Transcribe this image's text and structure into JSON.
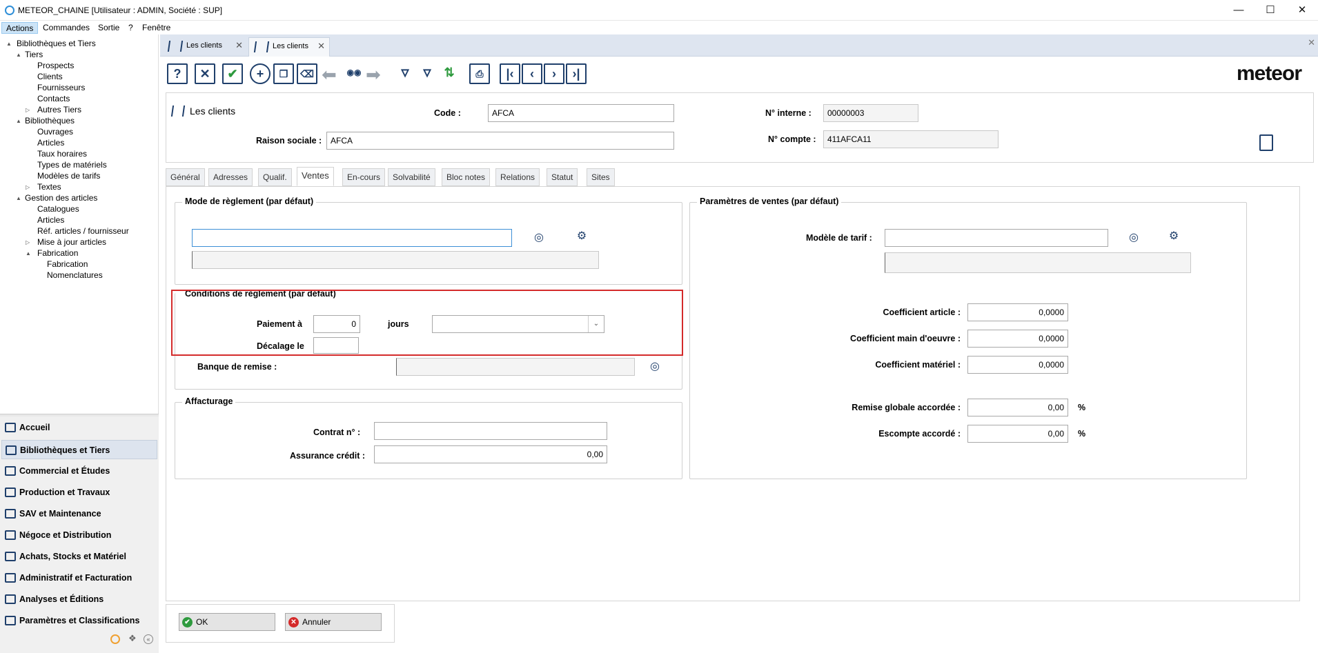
{
  "window": {
    "title": "METEOR_CHAINE [Utilisateur : ADMIN, Société : SUP]"
  },
  "menu": [
    "Actions",
    "Commandes",
    "Sortie",
    "?",
    "Fenêtre"
  ],
  "tree": [
    {
      "label": "Bibliothèques et Tiers",
      "level": 0,
      "expander": "▲"
    },
    {
      "label": "Tiers",
      "level": 1,
      "expander": "▲"
    },
    {
      "label": "Prospects",
      "level": 2
    },
    {
      "label": "Clients",
      "level": 2
    },
    {
      "label": "Fournisseurs",
      "level": 2
    },
    {
      "label": "Contacts",
      "level": 2
    },
    {
      "label": "Autres Tiers",
      "level": 2,
      "expander": "▷"
    },
    {
      "label": "Bibliothèques",
      "level": 1,
      "expander": "▲"
    },
    {
      "label": "Ouvrages",
      "level": 2
    },
    {
      "label": "Articles",
      "level": 2
    },
    {
      "label": "Taux horaires",
      "level": 2
    },
    {
      "label": "Types de matériels",
      "level": 2
    },
    {
      "label": "Modèles de tarifs",
      "level": 2
    },
    {
      "label": "Textes",
      "level": 2,
      "expander": "▷"
    },
    {
      "label": "Gestion des articles",
      "level": 1,
      "expander": "▲"
    },
    {
      "label": "Catalogues",
      "level": 2
    },
    {
      "label": "Articles",
      "level": 2
    },
    {
      "label": "Réf. articles / fournisseur",
      "level": 2
    },
    {
      "label": "Mise à jour articles",
      "level": 2,
      "expander": "▷"
    },
    {
      "label": "Fabrication",
      "level": 2,
      "expander": "▲"
    },
    {
      "label": "Fabrication",
      "level": 3
    },
    {
      "label": "Nomenclatures",
      "level": 3
    }
  ],
  "modules": [
    "Accueil",
    "Bibliothèques et Tiers",
    "Commercial et Études",
    "Production et Travaux",
    "SAV et Maintenance",
    "Négoce et Distribution",
    "Achats, Stocks et Matériel",
    "Administratif et Facturation",
    "Analyses et Éditions",
    "Paramètres et Classifications"
  ],
  "doc_tabs": [
    "Les clients",
    "Les clients"
  ],
  "logo": "meteor",
  "header": {
    "title": "Les clients",
    "code_label": "Code :",
    "code_value": "AFCA",
    "raison_label": "Raison sociale :",
    "raison_value": "AFCA",
    "ninterne_label": "N° interne :",
    "ninterne_value": "00000003",
    "ncompte_label": "N° compte :",
    "ncompte_value": "411AFCA11"
  },
  "subtabs": [
    "Général",
    "Adresses",
    "Qualif.",
    "Ventes",
    "En-cours",
    "Solvabilité",
    "Bloc notes",
    "Relations",
    "Statut",
    "Sites"
  ],
  "ventes": {
    "mode_reglement_title": "Mode de règlement (par défaut)",
    "conditions_title": "Conditions de règlement (par défaut)",
    "paiement_label": "Paiement à",
    "paiement_value": "0",
    "jours_label": "jours",
    "decalage_label": "Décalage le",
    "banque_label": "Banque de remise :",
    "affacturage_title": "Affacturage",
    "contrat_label": "Contrat n° :",
    "assurance_label": "Assurance crédit :",
    "assurance_value": "0,00",
    "params_title": "Paramètres de ventes (par défaut)",
    "modele_tarif_label": "Modèle de tarif :",
    "coef_article_label": "Coefficient article :",
    "coef_article_value": "0,0000",
    "coef_mo_label": "Coefficient main d'oeuvre :",
    "coef_mo_value": "0,0000",
    "coef_mat_label": "Coefficient matériel :",
    "coef_mat_value": "0,0000",
    "remise_label": "Remise globale accordée :",
    "remise_value": "0,00",
    "escompte_label": "Escompte accordé :",
    "escompte_value": "0,00",
    "percent": "%"
  },
  "buttons": {
    "ok": "OK",
    "cancel": "Annuler"
  },
  "colors": {
    "accent": "#1f3f6b",
    "highlight": "#d42a2a",
    "ok": "#2e9a3e",
    "cancel": "#d42a2a"
  }
}
